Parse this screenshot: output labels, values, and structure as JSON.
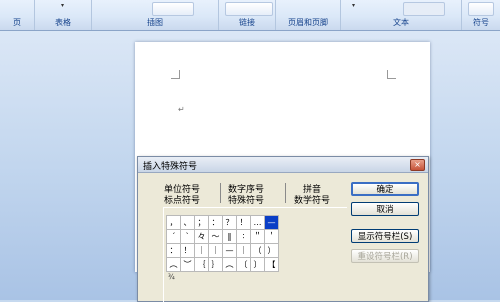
{
  "ribbon": {
    "groups": [
      {
        "label": "页"
      },
      {
        "label": "表格"
      },
      {
        "label": "插图"
      },
      {
        "label": "链接"
      },
      {
        "label": "页眉和页脚"
      },
      {
        "label": "文本"
      },
      {
        "label": "符号"
      }
    ]
  },
  "document": {
    "paragraph_mark": "↵"
  },
  "dialog": {
    "title": "插入特殊符号",
    "close_glyph": "×",
    "tabs": [
      {
        "label": "单位符号"
      },
      {
        "label": "数字序号"
      },
      {
        "label": "拼音"
      },
      {
        "label": "标点符号"
      },
      {
        "label": "特殊符号"
      },
      {
        "label": "数学符号"
      }
    ],
    "symbols": [
      [
        "，",
        "、",
        "；",
        "：",
        "？",
        "！",
        "…",
        "—"
      ],
      [
        "ˊ",
        "ˋ",
        "々",
        "～",
        "‖",
        "∶",
        "＂",
        "＇"
      ],
      [
        "：",
        "！",
        "｜",
        "｜",
        "—",
        "｜",
        "（",
        "）"
      ],
      [
        "︵",
        "︶",
        "｛",
        "｝",
        "︵",
        "〔",
        "〕",
        "【"
      ]
    ],
    "selected": {
      "row": 0,
      "col": 7
    },
    "bottom_mark": "¾",
    "buttons": {
      "ok": "确定",
      "cancel": "取消",
      "show_toolbar": "显示符号栏(S)",
      "reset_toolbar": "重设符号栏(R)"
    }
  }
}
